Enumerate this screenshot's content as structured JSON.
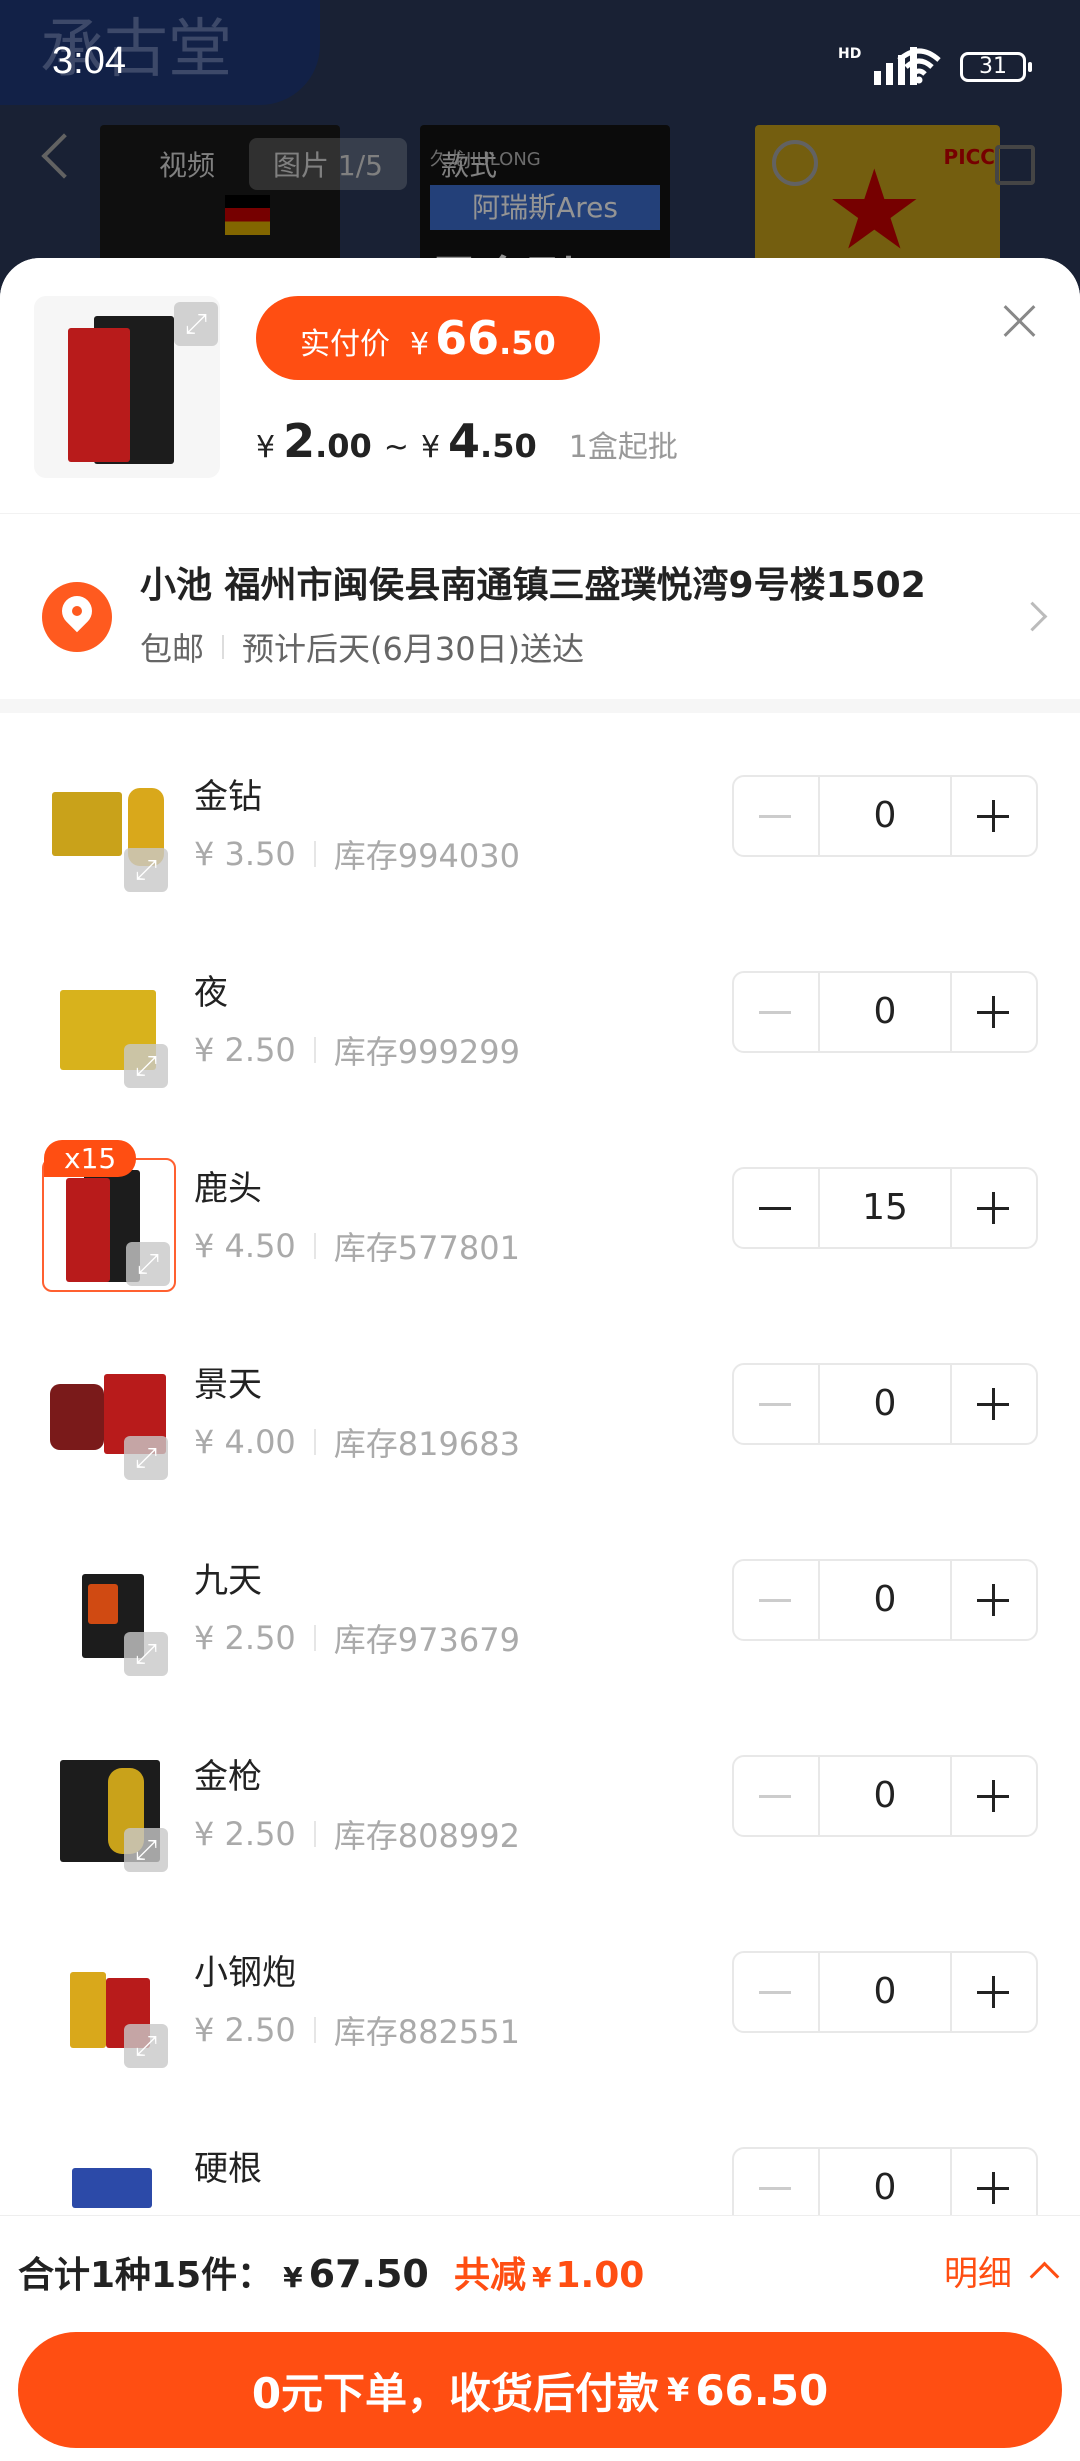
{
  "status_bar": {
    "time": "3:04",
    "network": "HD",
    "battery": "31"
  },
  "background": {
    "shop_logo": "承古堂",
    "tabs": [
      {
        "label": "视频"
      },
      {
        "label": "图片 1/5"
      },
      {
        "label": "款式"
      }
    ],
    "product_texts": [
      "久龙JIULONG",
      "阿瑞斯Ares",
      "黑金刚",
      "PICC"
    ]
  },
  "header": {
    "paid_label": "实付价",
    "currency": "¥",
    "paid_int": "66",
    "paid_dec": ".50",
    "range_min_int": "2",
    "range_min_dec": ".00",
    "range_sep": "~",
    "range_max_int": "4",
    "range_max_dec": ".50",
    "min_order": "1盒起批"
  },
  "address": {
    "main": "小池 福州市闽侯县南通镇三盛璞悦湾9号楼1502",
    "shipping": "包邮",
    "eta": "预计后天(6月30日)送达"
  },
  "items": [
    {
      "name": "金钻",
      "price": "¥ 3.50",
      "stock": "库存994030",
      "qty": "0"
    },
    {
      "name": "夜",
      "price": "¥ 2.50",
      "stock": "库存999299",
      "qty": "0"
    },
    {
      "name": "鹿头",
      "price": "¥ 4.50",
      "stock": "库存577801",
      "qty": "15",
      "badge": "x15"
    },
    {
      "name": "景天",
      "price": "¥ 4.00",
      "stock": "库存819683",
      "qty": "0"
    },
    {
      "name": "九天",
      "price": "¥ 2.50",
      "stock": "库存973679",
      "qty": "0"
    },
    {
      "name": "金枪",
      "price": "¥ 2.50",
      "stock": "库存808992",
      "qty": "0"
    },
    {
      "name": "小钢炮",
      "price": "¥ 2.50",
      "stock": "库存882551",
      "qty": "0"
    },
    {
      "name": "硬根",
      "price": "",
      "stock": "",
      "qty": "0"
    }
  ],
  "footer": {
    "total_label": "合计1种15件：",
    "currency": "¥",
    "total": "67.50",
    "save_label": "共减",
    "save": "1.00",
    "detail": "明细",
    "cta_label": "0元下单，收货后付款",
    "cta_amount": "66.50"
  },
  "colors": {
    "accent": "#ff4e12",
    "text": "#222222",
    "muted": "#aaaaaa"
  }
}
